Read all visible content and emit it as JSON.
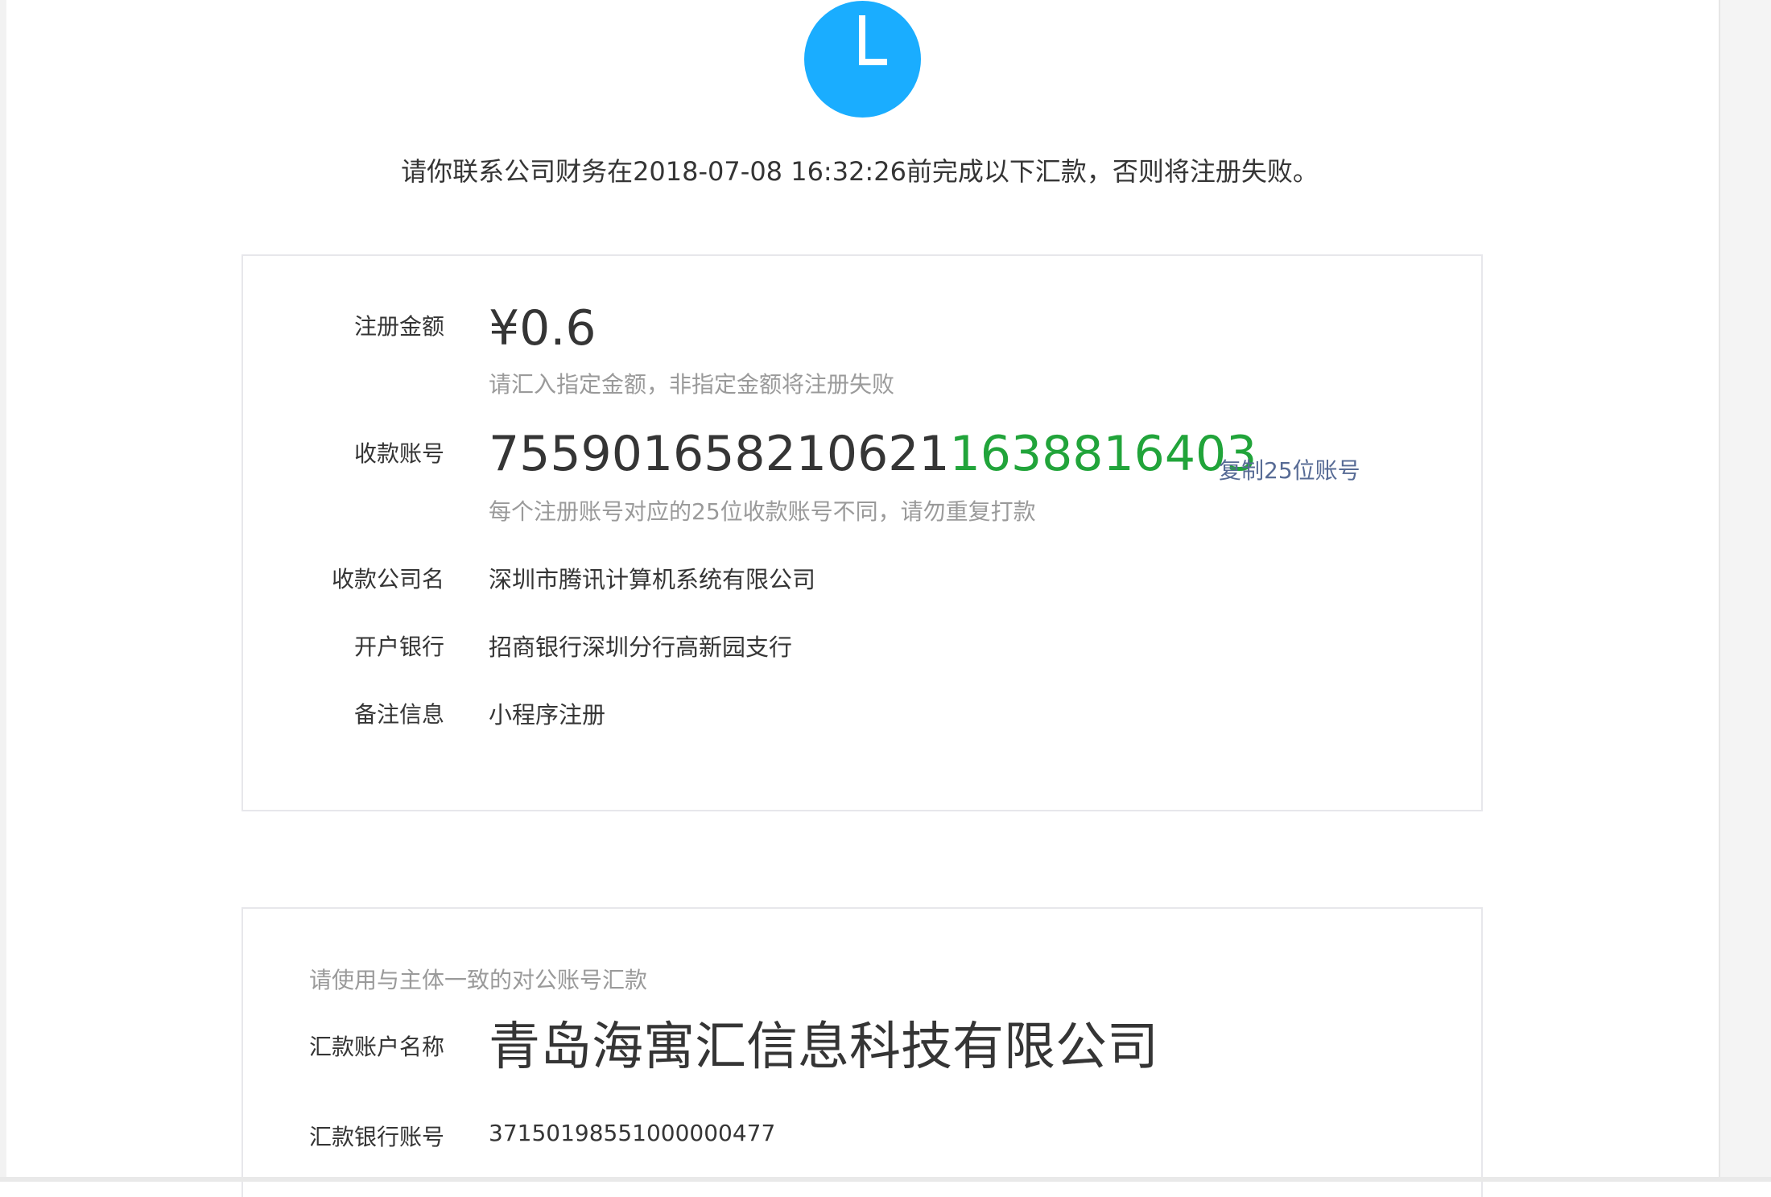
{
  "header": {
    "icon": "clock-icon",
    "icon_color": "#1aadff",
    "notice": "请你联系公司财务在2018-07-08 16:32:26前完成以下汇款，否则将注册失败。"
  },
  "payment": {
    "amount_label": "注册金额",
    "amount_value": "¥0.6",
    "amount_hint": "请汇入指定金额，非指定金额将注册失败",
    "account_label": "收款账号",
    "account_prefix": "755901658210621",
    "account_suffix": "1638816403",
    "account_suffix_color": "#21a43a",
    "copy_label": "复制25位账号",
    "account_hint": "每个注册账号对应的25位收款账号不同，请勿重复打款",
    "company_label": "收款公司名",
    "company_value": "深圳市腾讯计算机系统有限公司",
    "bank_label": "开户银行",
    "bank_value": "招商银行深圳分行高新园支行",
    "remark_label": "备注信息",
    "remark_value": "小程序注册"
  },
  "remitter": {
    "tip": "请使用与主体一致的对公账号汇款",
    "name_label": "汇款账户名称",
    "name_value": "青岛海寓汇信息科技有限公司",
    "bank_account_label": "汇款银行账号",
    "bank_account_value": "37150198551000000477"
  }
}
